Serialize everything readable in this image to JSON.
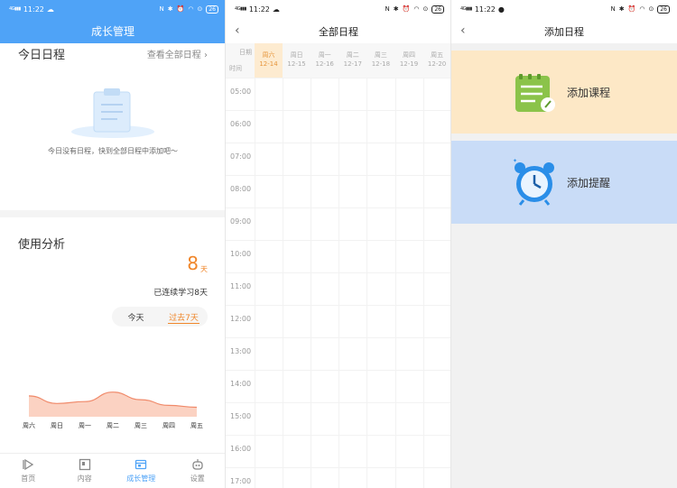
{
  "status": {
    "time": "11:22",
    "signal": "4G|||",
    "battery": "26"
  },
  "home": {
    "title": "成长管理",
    "today_section": "今日日程",
    "view_all": "查看全部日程",
    "empty_text": "今日没有日程，快到全部日程中添加吧～",
    "usage_section": "使用分析",
    "streak_days": "8",
    "streak_unit": "天",
    "streak_text": "已连续学习8天",
    "segment": {
      "today": "今天",
      "past7": "过去7天"
    },
    "tabs": [
      {
        "label": "首页",
        "icon": "play-icon"
      },
      {
        "label": "内容",
        "icon": "content-icon"
      },
      {
        "label": "成长管理",
        "icon": "growth-icon"
      },
      {
        "label": "设置",
        "icon": "robot-icon"
      }
    ]
  },
  "chart_data": {
    "type": "area",
    "categories": [
      "周六",
      "周日",
      "周一",
      "周二",
      "周三",
      "周四",
      "周五"
    ],
    "values": [
      0.55,
      0.35,
      0.4,
      0.65,
      0.45,
      0.3,
      0.25
    ],
    "color": "#f08a6a"
  },
  "schedule": {
    "title": "全部日程",
    "corner_top": "日期",
    "corner_bottom": "时间",
    "days": [
      {
        "weekday": "周六",
        "date": "12-14",
        "today": true
      },
      {
        "weekday": "周日",
        "date": "12-15",
        "today": false
      },
      {
        "weekday": "周一",
        "date": "12-16",
        "today": false
      },
      {
        "weekday": "周二",
        "date": "12-17",
        "today": false
      },
      {
        "weekday": "周三",
        "date": "12-18",
        "today": false
      },
      {
        "weekday": "周四",
        "date": "12-19",
        "today": false
      },
      {
        "weekday": "周五",
        "date": "12-20",
        "today": false
      }
    ],
    "hours": [
      "05:00",
      "06:00",
      "07:00",
      "08:00",
      "09:00",
      "10:00",
      "11:00",
      "12:00",
      "13:00",
      "14:00",
      "15:00",
      "16:00",
      "17:00"
    ]
  },
  "add": {
    "title": "添加日程",
    "course": "添加课程",
    "remind": "添加提醒"
  }
}
